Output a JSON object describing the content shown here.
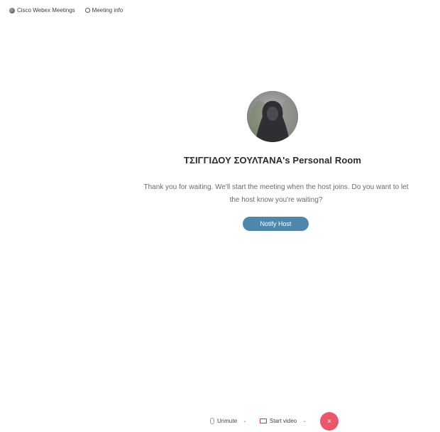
{
  "topbar": {
    "app_label": "Cisco Webex Meetings",
    "app_icon": "webex-globe-icon",
    "info_label": "Meeting info",
    "info_icon": "info-circle-icon"
  },
  "room": {
    "title": "ΤΣΙΓΓΙΔΟΥ ΣΟΥΛΤΑΝΑ's Personal Room",
    "message": "Thank you for waiting. We'll start the meeting when the host joins. Do you want to let the host know you're waiting?",
    "notify_label": "Notify Host"
  },
  "controls": {
    "unmute_label": "Unmute",
    "start_video_label": "Start video",
    "chevron": "⌄",
    "leave_icon_glyph": "×"
  },
  "colors": {
    "accent": "#4f87aa",
    "leave": "#e8586a",
    "video_icon": "#c23c3c"
  }
}
